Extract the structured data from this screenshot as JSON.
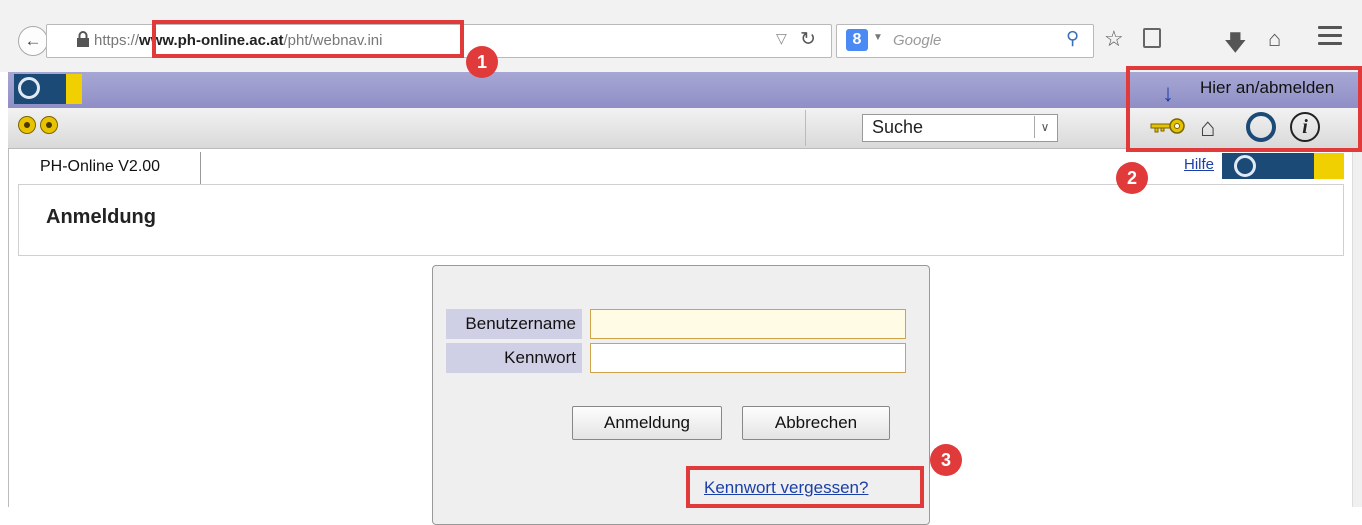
{
  "browser": {
    "url_prefix": "https://",
    "url_host": "www.ph-online.ac.at",
    "url_path": "/pht/webnav.ini",
    "search_placeholder": "Google",
    "icons": [
      "back-icon",
      "lock-icon",
      "reload-icon",
      "google-icon",
      "search-icon",
      "star-icon",
      "bookmarks-icon",
      "download-icon",
      "home-icon",
      "menu-icon"
    ]
  },
  "header": {
    "login_hint": "Hier an/abmelden"
  },
  "toolbar": {
    "search_label": "Suche",
    "icons": [
      "key-icon",
      "house-icon",
      "ph-logo-icon",
      "info-icon"
    ]
  },
  "tab": {
    "label": "PH-Online V2.00",
    "help_link": "Hilfe"
  },
  "page": {
    "title": "Anmeldung"
  },
  "login_form": {
    "username_label": "Benutzername",
    "password_label": "Kennwort",
    "username_value": "",
    "password_value": "",
    "login_button": "Anmeldung",
    "cancel_button": "Abbrechen",
    "forgot_link": "Kennwort vergessen?"
  },
  "annotations": {
    "badge_1": "1",
    "badge_2": "2",
    "badge_3": "3",
    "color": "#e03a3a"
  }
}
